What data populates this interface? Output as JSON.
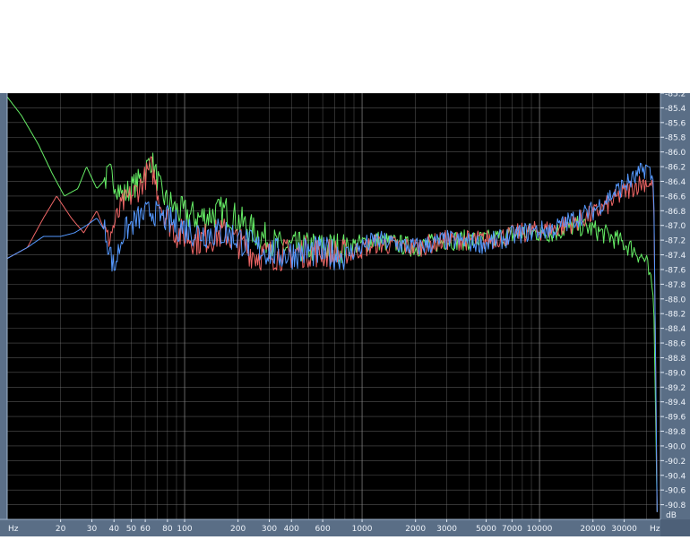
{
  "chart_data": {
    "type": "line",
    "title": "",
    "x_unit_label": "Hz",
    "y_unit_label": "dB",
    "x_scale": "log",
    "xlim": [
      10,
      48000
    ],
    "ylim": [
      -91.0,
      -85.2
    ],
    "grid": true,
    "legend": "none",
    "x_tick_labels": [
      {
        "value": 20,
        "label": "20"
      },
      {
        "value": 30,
        "label": "30"
      },
      {
        "value": 40,
        "label": "40"
      },
      {
        "value": 50,
        "label": "50"
      },
      {
        "value": 60,
        "label": "60"
      },
      {
        "value": 80,
        "label": "80"
      },
      {
        "value": 100,
        "label": "100"
      },
      {
        "value": 200,
        "label": "200"
      },
      {
        "value": 300,
        "label": "300"
      },
      {
        "value": 400,
        "label": "400"
      },
      {
        "value": 600,
        "label": "600"
      },
      {
        "value": 1000,
        "label": "1000"
      },
      {
        "value": 2000,
        "label": "2000"
      },
      {
        "value": 3000,
        "label": "3000"
      },
      {
        "value": 5000,
        "label": "5000"
      },
      {
        "value": 7000,
        "label": "7000"
      },
      {
        "value": 10000,
        "label": "10000"
      },
      {
        "value": 20000,
        "label": "20000"
      },
      {
        "value": 30000,
        "label": "30000"
      }
    ],
    "y_tick_labels": [
      "-85.2",
      "-85.4",
      "-85.6",
      "-85.8",
      "-86.0",
      "-86.2",
      "-86.4",
      "-86.6",
      "-86.8",
      "-87.0",
      "-87.2",
      "-87.4",
      "-87.6",
      "-87.8",
      "-88.0",
      "-88.2",
      "-88.4",
      "-88.6",
      "-88.8",
      "-89.0",
      "-89.2",
      "-89.4",
      "-89.6",
      "-89.8",
      "-90.0",
      "-90.2",
      "-90.4",
      "-90.6",
      "-90.8"
    ],
    "series": [
      {
        "color": "#66ee66",
        "points": [
          [
            10,
            -85.25
          ],
          [
            12,
            -85.5
          ],
          [
            15,
            -85.9
          ],
          [
            18,
            -86.3
          ],
          [
            21,
            -86.6
          ],
          [
            25,
            -86.5
          ],
          [
            28,
            -86.2
          ],
          [
            32,
            -86.5
          ],
          [
            38,
            -86.3
          ],
          [
            45,
            -86.6
          ],
          [
            55,
            -86.4
          ],
          [
            65,
            -86.1
          ],
          [
            75,
            -86.6
          ],
          [
            90,
            -86.8
          ],
          [
            120,
            -86.9
          ],
          [
            170,
            -86.8
          ],
          [
            250,
            -87.1
          ],
          [
            350,
            -87.3
          ],
          [
            500,
            -87.3
          ],
          [
            800,
            -87.3
          ],
          [
            1200,
            -87.2
          ],
          [
            2000,
            -87.3
          ],
          [
            3000,
            -87.2
          ],
          [
            5000,
            -87.2
          ],
          [
            8000,
            -87.1
          ],
          [
            12000,
            -87.1
          ],
          [
            16000,
            -87.0
          ],
          [
            20000,
            -87.05
          ],
          [
            25000,
            -87.15
          ],
          [
            30000,
            -87.25
          ],
          [
            35000,
            -87.35
          ],
          [
            40000,
            -87.5
          ],
          [
            44000,
            -88.0
          ],
          [
            46000,
            -90.9
          ]
        ]
      },
      {
        "color": "#ee6666",
        "points": [
          [
            10,
            -87.45
          ],
          [
            13,
            -87.3
          ],
          [
            16,
            -86.9
          ],
          [
            19,
            -86.6
          ],
          [
            23,
            -86.9
          ],
          [
            27,
            -87.1
          ],
          [
            32,
            -86.8
          ],
          [
            37,
            -87.2
          ],
          [
            45,
            -86.7
          ],
          [
            55,
            -86.5
          ],
          [
            65,
            -86.2
          ],
          [
            75,
            -86.8
          ],
          [
            90,
            -87.1
          ],
          [
            120,
            -87.2
          ],
          [
            170,
            -87.1
          ],
          [
            250,
            -87.4
          ],
          [
            350,
            -87.4
          ],
          [
            500,
            -87.35
          ],
          [
            800,
            -87.4
          ],
          [
            1200,
            -87.25
          ],
          [
            2000,
            -87.3
          ],
          [
            3000,
            -87.2
          ],
          [
            5000,
            -87.2
          ],
          [
            8000,
            -87.1
          ],
          [
            12000,
            -87.05
          ],
          [
            16000,
            -86.95
          ],
          [
            20000,
            -86.85
          ],
          [
            25000,
            -86.7
          ],
          [
            30000,
            -86.55
          ],
          [
            35000,
            -86.45
          ],
          [
            40000,
            -86.4
          ],
          [
            44000,
            -86.5
          ],
          [
            46000,
            -90.9
          ]
        ]
      },
      {
        "color": "#5599ff",
        "points": [
          [
            10,
            -87.45
          ],
          [
            13,
            -87.3
          ],
          [
            16,
            -87.15
          ],
          [
            20,
            -87.15
          ],
          [
            24,
            -87.1
          ],
          [
            28,
            -87.0
          ],
          [
            32,
            -86.9
          ],
          [
            36,
            -87.1
          ],
          [
            40,
            -87.6
          ],
          [
            45,
            -87.1
          ],
          [
            55,
            -86.9
          ],
          [
            65,
            -86.8
          ],
          [
            75,
            -86.9
          ],
          [
            90,
            -87.0
          ],
          [
            120,
            -87.1
          ],
          [
            170,
            -87.1
          ],
          [
            250,
            -87.3
          ],
          [
            350,
            -87.4
          ],
          [
            500,
            -87.35
          ],
          [
            800,
            -87.4
          ],
          [
            1200,
            -87.2
          ],
          [
            2000,
            -87.3
          ],
          [
            3000,
            -87.2
          ],
          [
            5000,
            -87.25
          ],
          [
            8000,
            -87.1
          ],
          [
            12000,
            -87.05
          ],
          [
            16000,
            -86.9
          ],
          [
            20000,
            -86.8
          ],
          [
            25000,
            -86.6
          ],
          [
            30000,
            -86.45
          ],
          [
            35000,
            -86.35
          ],
          [
            40000,
            -86.2
          ],
          [
            44000,
            -86.4
          ],
          [
            46000,
            -90.9
          ]
        ]
      }
    ]
  }
}
